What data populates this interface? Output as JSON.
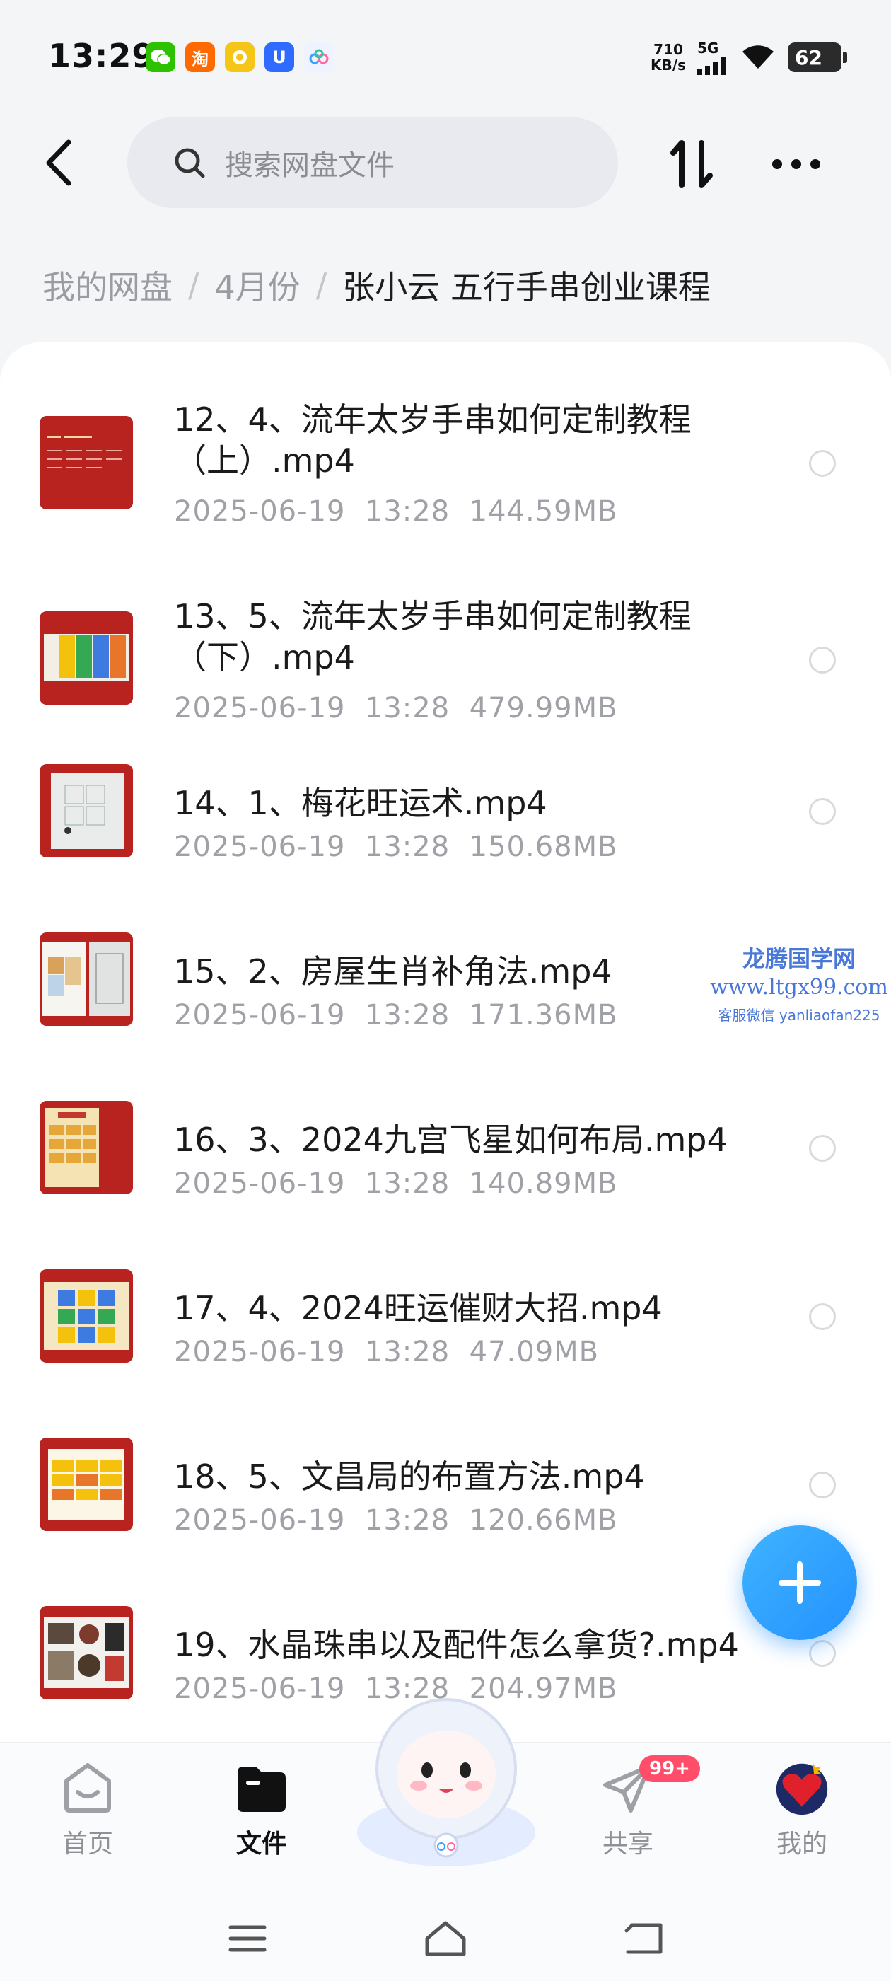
{
  "status_bar": {
    "time": "13:29",
    "net_speed_value": "710",
    "net_speed_unit": "KB/s",
    "network": "5G",
    "battery": "62",
    "apps": [
      {
        "icon": "wechat-icon",
        "glyph": "✆",
        "color": "#2dc100"
      },
      {
        "icon": "taobao-icon",
        "glyph": "淘",
        "color": "#ff6a00"
      },
      {
        "icon": "yellow-app-icon",
        "glyph": "☺",
        "color": "#f5c518"
      },
      {
        "icon": "blue-u-app-icon",
        "glyph": "U",
        "color": "#2f6bff"
      },
      {
        "icon": "netdisk-app-icon",
        "glyph": "∞",
        "color": "#e8f0ff"
      }
    ]
  },
  "search": {
    "placeholder": "搜索网盘文件"
  },
  "breadcrumb": {
    "items": [
      "我的网盘",
      "4月份"
    ],
    "separator": "/",
    "current": "张小云 五行手串创业课程"
  },
  "files": [
    {
      "name": "12、4、流年太岁手串如何定制教程（上）.mp4",
      "date": "2025-06-19",
      "time": "13:28",
      "size": "144.59MB"
    },
    {
      "name": "13、5、流年太岁手串如何定制教程（下）.mp4",
      "date": "2025-06-19",
      "time": "13:28",
      "size": "479.99MB"
    },
    {
      "name": "14、1、梅花旺运术.mp4",
      "date": "2025-06-19",
      "time": "13:28",
      "size": "150.68MB"
    },
    {
      "name": "15、2、房屋生肖补角法.mp4",
      "date": "2025-06-19",
      "time": "13:28",
      "size": "171.36MB"
    },
    {
      "name": "16、3、2024九宫飞星如何布局.mp4",
      "date": "2025-06-19",
      "time": "13:28",
      "size": "140.89MB"
    },
    {
      "name": "17、4、2024旺运催财大招.mp4",
      "date": "2025-06-19",
      "time": "13:28",
      "size": "47.09MB"
    },
    {
      "name": "18、5、文昌局的布置方法.mp4",
      "date": "2025-06-19",
      "time": "13:28",
      "size": "120.66MB"
    },
    {
      "name": "19、水晶珠串以及配件怎么拿货?.mp4",
      "date": "2025-06-19",
      "time": "13:28",
      "size": "204.97MB"
    }
  ],
  "watermark": {
    "title": "龙腾国学网",
    "url": "www.ltgx99.com",
    "contact": "客服微信 yanliaofan225"
  },
  "bottom_nav": {
    "items": [
      {
        "label": "首页",
        "icon": "home-icon"
      },
      {
        "label": "文件",
        "icon": "folder-icon",
        "active": true
      },
      {
        "label": "共享",
        "icon": "send-icon",
        "badge": "99+"
      },
      {
        "label": "我的",
        "icon": "avatar-icon"
      }
    ]
  },
  "colors": {
    "accent": "#2491ff",
    "thumb_red": "#c42a2a",
    "badge": "#ff4d6a"
  }
}
